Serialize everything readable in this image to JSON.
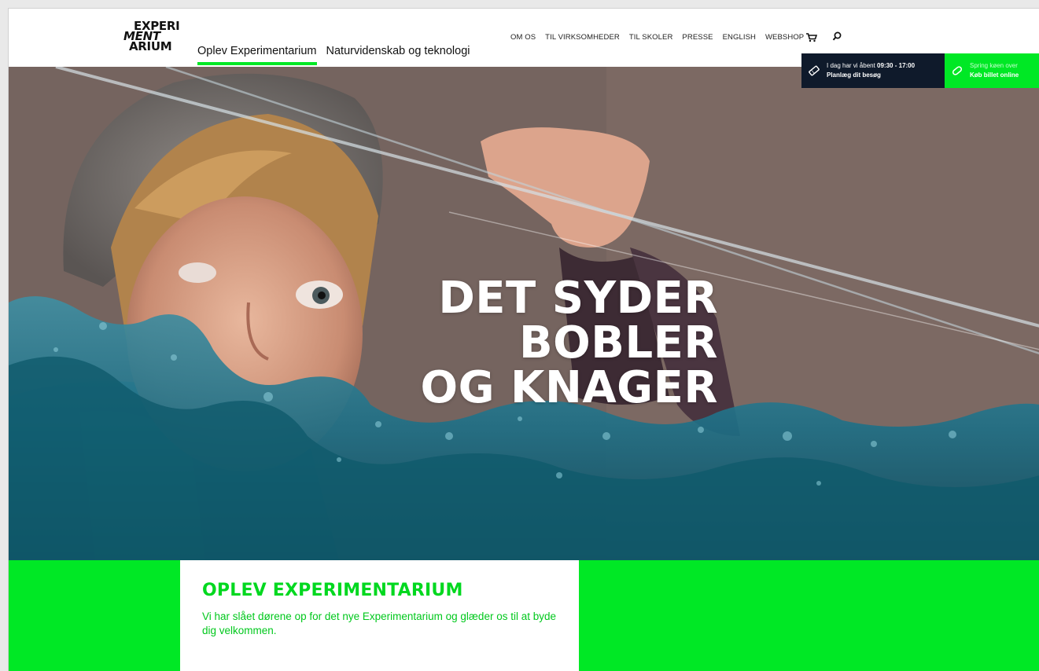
{
  "logo": {
    "line1": "EXPERI",
    "line2": "MENT",
    "line3": "ARIUM"
  },
  "main_nav": [
    {
      "label": "Oplev Experimentarium",
      "active": true
    },
    {
      "label": "Naturvidenskab og teknologi",
      "active": false
    }
  ],
  "top_nav": [
    "OM OS",
    "TIL VIRKSOMHEDER",
    "TIL SKOLER",
    "PRESSE",
    "ENGLISH",
    "WEBSHOP"
  ],
  "icons": {
    "cart": "cart-icon",
    "search": "search-icon",
    "ticket": "ticket-icon",
    "tag": "tag-icon"
  },
  "hours_box": {
    "prefix": "I dag har vi åbent ",
    "hours": "09:30 - 17:00",
    "link": "Planlæg dit besøg"
  },
  "ticket_box": {
    "line1": "Spring køen over",
    "link": "Køb billet online"
  },
  "hero": {
    "line1": "DET SYDER",
    "line2": "BOBLER",
    "line3": "OG KNAGER"
  },
  "intro": {
    "title": "OPLEV EXPERIMENTARIUM",
    "text": "Vi har slået dørene op for det nye Experimentarium og glæder os til at byde dig velkommen."
  },
  "colors": {
    "brand_green": "#00e825",
    "navy": "#0f1a2b"
  }
}
